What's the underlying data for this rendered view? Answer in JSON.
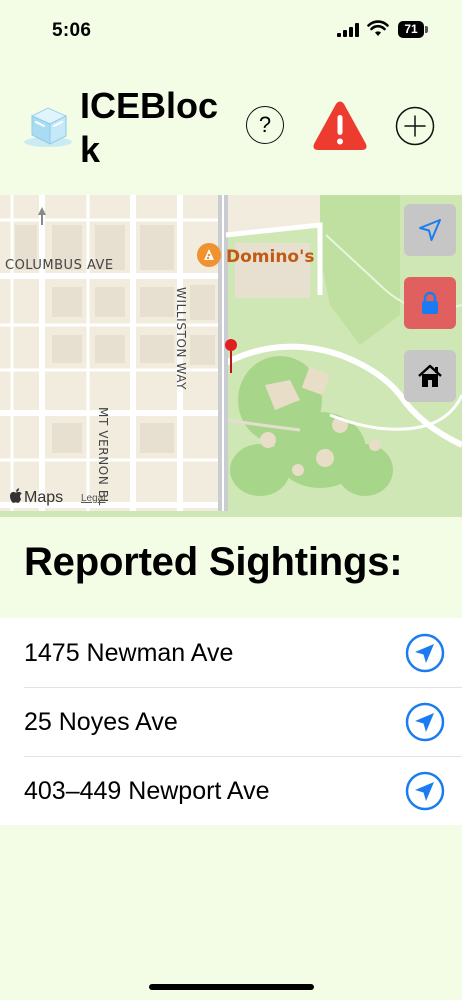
{
  "status_bar": {
    "time": "5:06",
    "battery": "71"
  },
  "header": {
    "title": "ICEBlock",
    "logo_icon": "ice-cube-icon",
    "help_label": "?",
    "report_icon": "warning-icon",
    "add_icon": "plus-icon"
  },
  "map": {
    "street_labels": {
      "columbus": "COLUMBUS AVE",
      "williston": "WILLISTON WAY",
      "mt_vernon": "MT VERNON BL"
    },
    "poi": "Domino's",
    "attribution": "Maps",
    "legal": "Legal",
    "controls": {
      "locate_icon": "location-arrow-icon",
      "lock_icon": "lock-icon",
      "home_icon": "house-icon"
    },
    "colors": {
      "lock_bg": "#e06060",
      "control_bg": "#c6c6c6",
      "pin": "#e02020"
    }
  },
  "sightings": {
    "title": "Reported Sightings:",
    "items": [
      {
        "address": "1475 Newman Ave"
      },
      {
        "address": "25 Noyes Ave"
      },
      {
        "address": "403–449 Newport Ave"
      }
    ],
    "navigate_icon": "location-arrow-icon",
    "accent": "#1a7cf0"
  }
}
